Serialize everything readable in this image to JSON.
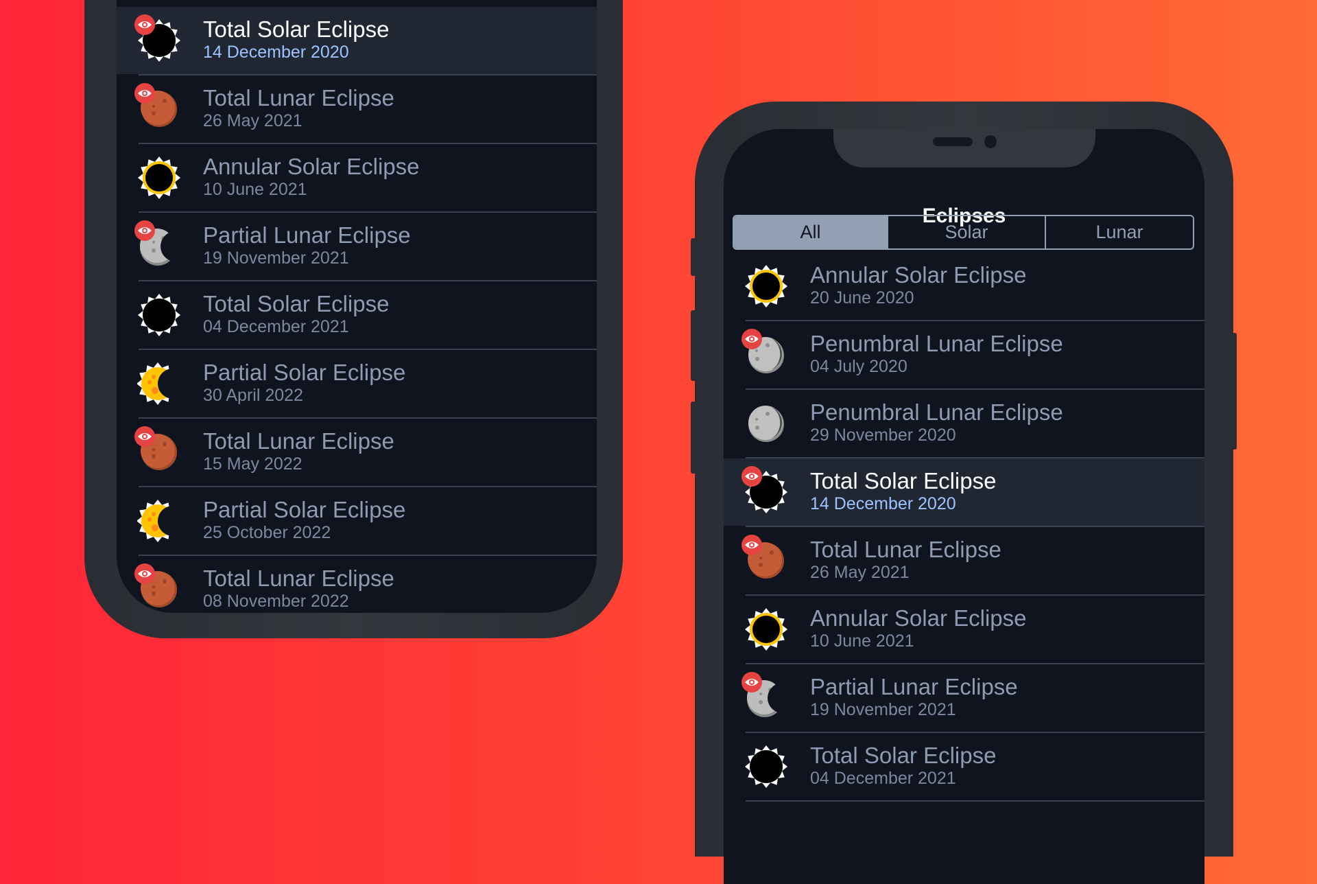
{
  "app": {
    "title": "Eclipses"
  },
  "filter": {
    "options": [
      "All",
      "Solar",
      "Lunar"
    ],
    "selected": "All"
  },
  "colors": {
    "accent_date": "#9cc2ff",
    "selected_segment": "#939fb3",
    "eye_badge": "#e84343"
  },
  "left_list": [
    {
      "name": "Total Solar Eclipse",
      "date": "14 December 2020",
      "type": "total-solar",
      "visible": true,
      "highlight": true
    },
    {
      "name": "Total Lunar Eclipse",
      "date": "26 May 2021",
      "type": "total-lunar",
      "visible": true
    },
    {
      "name": "Annular Solar Eclipse",
      "date": "10 June 2021",
      "type": "annular-solar",
      "visible": false
    },
    {
      "name": "Partial Lunar Eclipse",
      "date": "19 November 2021",
      "type": "partial-lunar",
      "visible": true
    },
    {
      "name": "Total Solar Eclipse",
      "date": "04 December 2021",
      "type": "total-solar",
      "visible": false
    },
    {
      "name": "Partial Solar Eclipse",
      "date": "30 April 2022",
      "type": "partial-solar",
      "visible": false
    },
    {
      "name": "Total Lunar Eclipse",
      "date": "15 May 2022",
      "type": "total-lunar",
      "visible": true
    },
    {
      "name": "Partial Solar Eclipse",
      "date": "25 October 2022",
      "type": "partial-solar",
      "visible": false
    },
    {
      "name": "Total Lunar Eclipse",
      "date": "08 November 2022",
      "type": "total-lunar",
      "visible": true
    }
  ],
  "right_list": [
    {
      "name": "Annular Solar Eclipse",
      "date": "20 June 2020",
      "type": "annular-solar",
      "visible": false
    },
    {
      "name": "Penumbral Lunar Eclipse",
      "date": "04 July 2020",
      "type": "penumbral-lunar",
      "visible": true
    },
    {
      "name": "Penumbral Lunar Eclipse",
      "date": "29 November 2020",
      "type": "penumbral-lunar",
      "visible": false
    },
    {
      "name": "Total Solar Eclipse",
      "date": "14 December 2020",
      "type": "total-solar",
      "visible": true,
      "highlight": true
    },
    {
      "name": "Total Lunar Eclipse",
      "date": "26 May 2021",
      "type": "total-lunar",
      "visible": true
    },
    {
      "name": "Annular Solar Eclipse",
      "date": "10 June 2021",
      "type": "annular-solar",
      "visible": false
    },
    {
      "name": "Partial Lunar Eclipse",
      "date": "19 November 2021",
      "type": "partial-lunar",
      "visible": true
    },
    {
      "name": "Total Solar Eclipse",
      "date": "04 December 2021",
      "type": "total-solar",
      "visible": false
    }
  ]
}
